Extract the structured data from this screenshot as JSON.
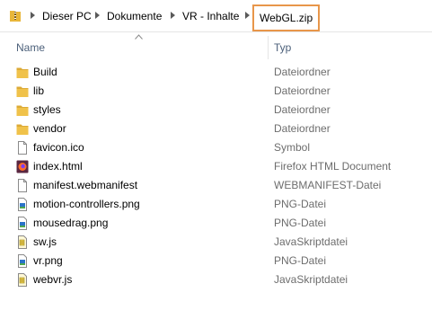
{
  "breadcrumb": [
    "Dieser PC",
    "Dokumente",
    "VR - Inhalte",
    "WebGL.zip"
  ],
  "columns": {
    "name": "Name",
    "type": "Typ"
  },
  "sort": {
    "column": "name",
    "direction": "ascending"
  },
  "files": [
    {
      "name": "Build",
      "type": "Dateiordner",
      "icon": "folder-icon"
    },
    {
      "name": "lib",
      "type": "Dateiordner",
      "icon": "folder-icon"
    },
    {
      "name": "styles",
      "type": "Dateiordner",
      "icon": "folder-icon"
    },
    {
      "name": "vendor",
      "type": "Dateiordner",
      "icon": "folder-icon"
    },
    {
      "name": "favicon.ico",
      "type": "Symbol",
      "icon": "file-icon"
    },
    {
      "name": "index.html",
      "type": "Firefox HTML Document",
      "icon": "firefox-icon"
    },
    {
      "name": "manifest.webmanifest",
      "type": "WEBMANIFEST-Datei",
      "icon": "file-icon"
    },
    {
      "name": "motion-controllers.png",
      "type": "PNG-Datei",
      "icon": "image-icon"
    },
    {
      "name": "mousedrag.png",
      "type": "PNG-Datei",
      "icon": "image-icon"
    },
    {
      "name": "sw.js",
      "type": "JavaSkriptdatei",
      "icon": "script-icon"
    },
    {
      "name": "vr.png",
      "type": "PNG-Datei",
      "icon": "image-icon"
    },
    {
      "name": "webvr.js",
      "type": "JavaSkriptdatei",
      "icon": "script-icon"
    }
  ],
  "colors": {
    "highlight_border": "#e8964a",
    "folder": "#e8b63a",
    "header_text": "#4c607a"
  }
}
